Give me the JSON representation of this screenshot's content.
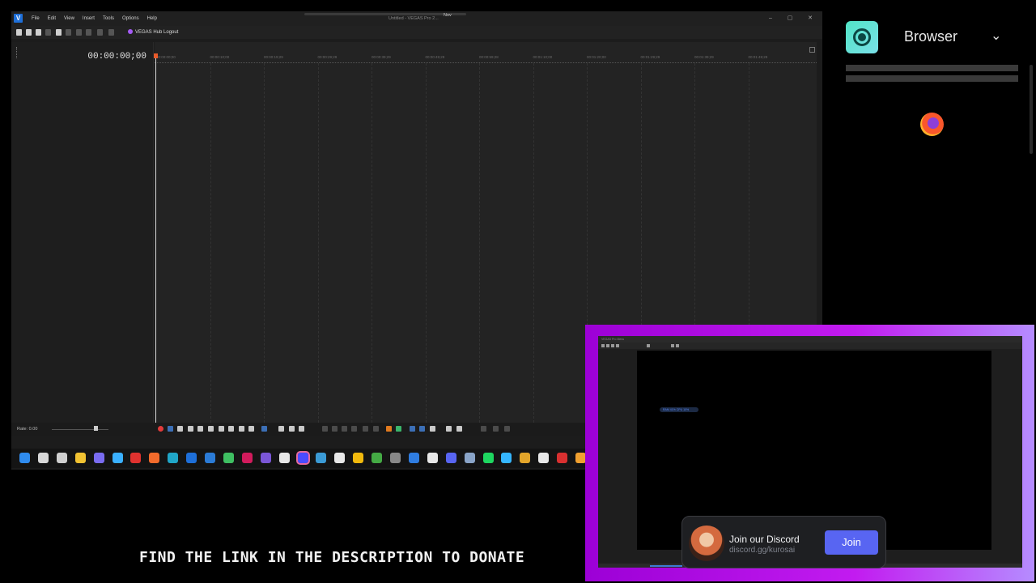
{
  "vegas": {
    "logo": "V",
    "menu": [
      "File",
      "Edit",
      "View",
      "Insert",
      "Tools",
      "Options",
      "Help"
    ],
    "window_title": "Untitled - VEGAS Pro 2...",
    "title_extra": "Nov",
    "hub_label": "VEGAS Hub Logout",
    "timecode": "00:00:00;00",
    "rate_label": "Rate: 0.00",
    "ruler_ticks": [
      "00:00:00;00",
      "00:00:10;00",
      "00:00:19;29",
      "00:00:29;29",
      "00:00:39;29",
      "00:00:49;29",
      "00:00:59;28",
      "00:01:10;00",
      "00:01:20;00",
      "00:01:29;29",
      "00:01:39;29",
      "00:01:49;29"
    ]
  },
  "taskbar": {
    "icons": [
      "windows-start",
      "search",
      "task-view",
      "file-explorer",
      "copilot",
      "checklist",
      "vivaldi",
      "firefox",
      "edge",
      "vegas",
      "photoshop",
      "android-studio",
      "davinci",
      "after-effects",
      "capcut",
      "obs",
      "photos",
      "notion",
      "chrome",
      "xbox",
      "terminal",
      "store",
      "media",
      "discord-app",
      "steam",
      "spotify",
      "app-a",
      "app-b",
      "app-c",
      "app-d",
      "app-e"
    ]
  },
  "sidebar": {
    "title": "Browser",
    "icon": "record-icon"
  },
  "pip": {
    "window_title": "VEGAS Pro Menu",
    "chip_text": "RAM 41% CPU 10%"
  },
  "discord": {
    "title": "Join our Discord",
    "subtitle": "discord.gg/kurosai",
    "button": "Join"
  },
  "caption": "FIND THE LINK IN THE DESCRIPTION TO DONATE",
  "colors": {
    "accent_purple": "#b81ff0",
    "discord_blue": "#5865f2",
    "record_teal": "#51e5c6"
  }
}
